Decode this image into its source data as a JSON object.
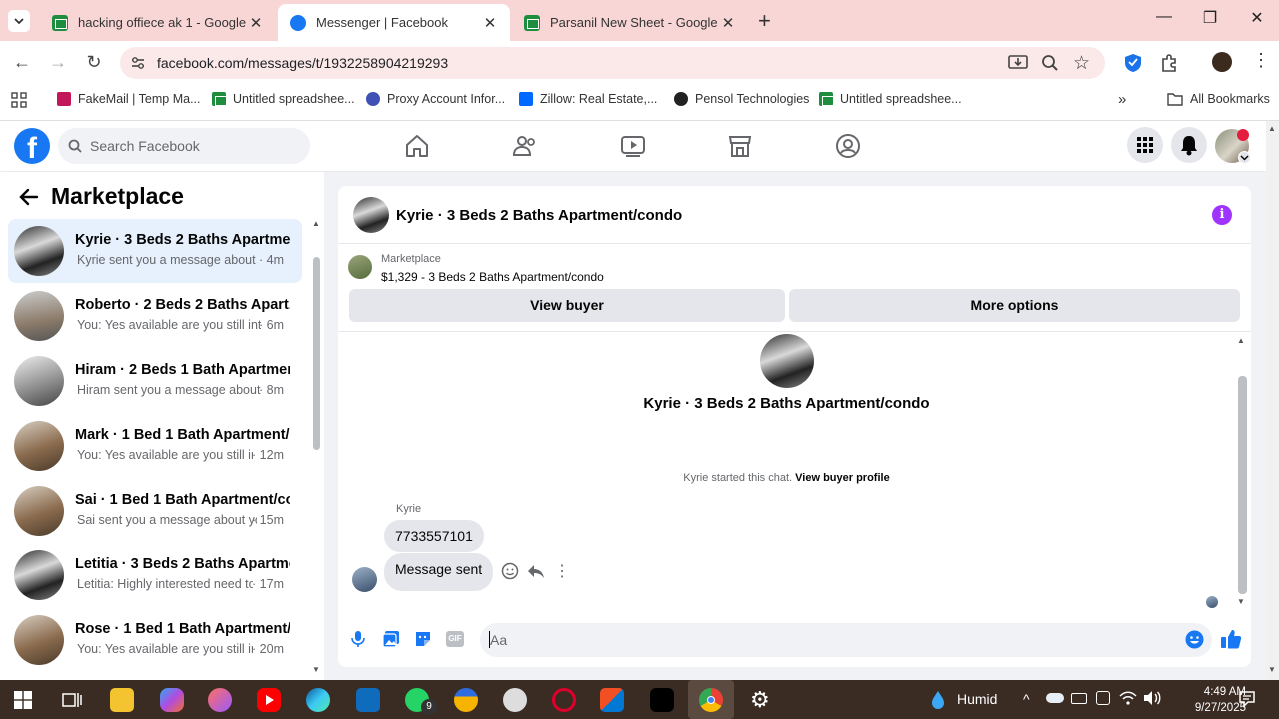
{
  "browser": {
    "tabs": [
      {
        "title": "hacking offiece ak 1 - Google Sh",
        "icon": "sheets-icon"
      },
      {
        "title": "Messenger | Facebook",
        "icon": "facebook-icon"
      },
      {
        "title": "Parsanil New Sheet - Google Sh",
        "icon": "sheets-icon"
      }
    ],
    "url": "facebook.com/messages/t/1932258904219293",
    "bookmarks": [
      "FakeMail | Temp Ma...",
      "Untitled spreadshee...",
      "Proxy Account Infor...",
      "Zillow: Real Estate,...",
      "Pensol Technologies",
      "Untitled spreadshee..."
    ],
    "all_bookmarks": "All Bookmarks"
  },
  "facebook": {
    "logo": "f",
    "search_placeholder": "Search Facebook"
  },
  "marketplace": {
    "title": "Marketplace",
    "conversations": [
      {
        "name": "Kyrie · 3 Beds 2 Baths Apartmen...",
        "snippet": "Kyrie sent you a message about yo...",
        "time": "· 4m"
      },
      {
        "name": "Roberto · 2 Beds 2 Baths Apart...",
        "snippet": "You: Yes available are you still inter...",
        "time": "· 6m"
      },
      {
        "name": "Hiram · 2 Beds 1 Bath Apartmen...",
        "snippet": "Hiram sent you a message about y...",
        "time": "· 8m"
      },
      {
        "name": "Mark · 1 Bed 1 Bath Apartment/...",
        "snippet": "You: Yes available are you still int...",
        "time": "· 12m"
      },
      {
        "name": "Sai · 1 Bed 1 Bath Apartment/co...",
        "snippet": "Sai sent you a message about yo...",
        "time": "· 15m"
      },
      {
        "name": "Letitia · 3 Beds 2 Baths Apartme...",
        "snippet": "Letitia: Highly interested need to ...",
        "time": "· 17m"
      },
      {
        "name": "Rose · 1 Bed 1 Bath Apartment/c...",
        "snippet": "You: Yes available are you still int...",
        "time": "· 20m"
      }
    ]
  },
  "chat": {
    "header_name": "Kyrie · 3 Beds 2 Baths Apartment/condo",
    "listing_label": "Marketplace",
    "listing_title": "$1,329 - 3 Beds 2 Baths Apartment/condo",
    "view_buyer": "View buyer",
    "more_options": "More options",
    "center_name": "Kyrie · 3 Beds 2 Baths Apartment/condo",
    "started_text": "Kyrie started this chat.",
    "view_buyer_profile": "View buyer profile",
    "sender": "Kyrie",
    "messages": [
      "7733557101",
      "Message sent"
    ],
    "composer_placeholder": "Aa",
    "gif": "GIF"
  },
  "taskbar": {
    "weather": "Humid",
    "time": "4:49 AM",
    "date": "9/27/2025",
    "whatsapp_badge": "9"
  },
  "colors": {
    "facebook_blue": "#1877f2",
    "messenger_purple": "#a033ff",
    "tabbar_bg": "#f9d6d6"
  }
}
